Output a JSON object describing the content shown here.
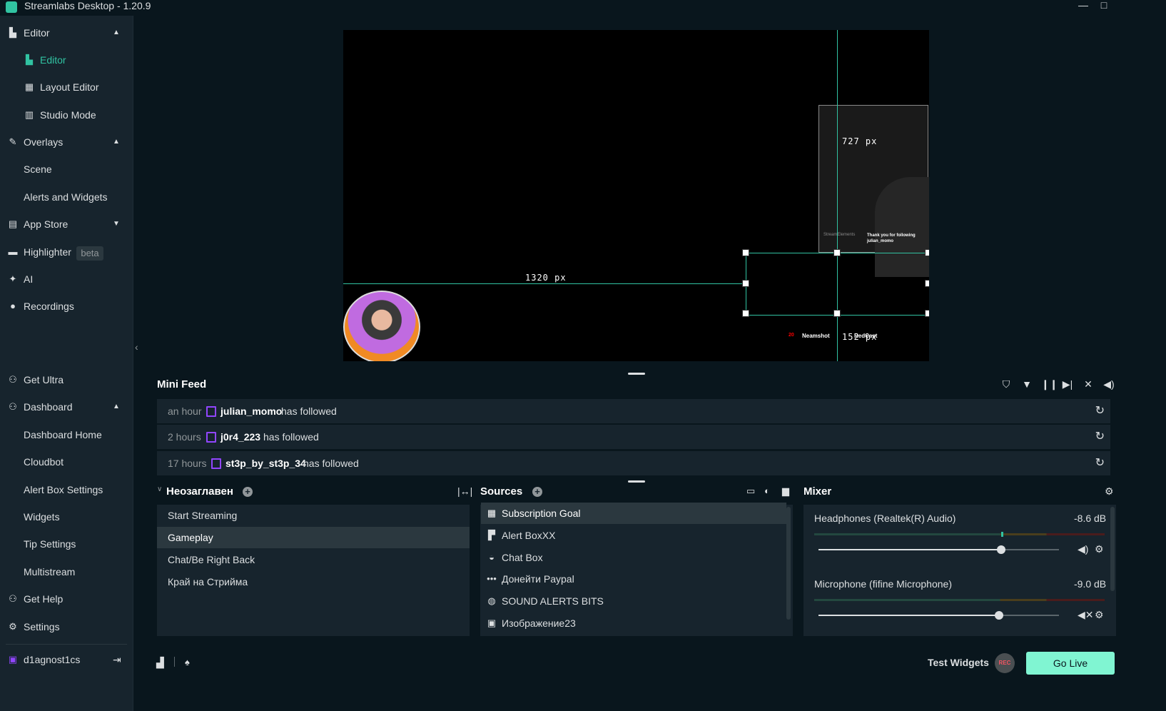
{
  "window": {
    "title": "Streamlabs Desktop - 1.20.9",
    "minimize": "—",
    "maximize": "□"
  },
  "sidebar": {
    "editor_group": "Editor",
    "editor_items": [
      "Editor",
      "Layout Editor",
      "Studio Mode"
    ],
    "overlays_group": "Overlays",
    "overlays_items": [
      "Scene",
      "Alerts and Widgets"
    ],
    "app_store": "App Store",
    "highlighter": "Highlighter",
    "highlighter_badge": "beta",
    "ai": "AI",
    "recordings": "Recordings",
    "get_ultra": "Get Ultra",
    "dashboard_group": "Dashboard",
    "dashboard_items": [
      "Dashboard Home",
      "Cloudbot",
      "Alert Box Settings",
      "Widgets",
      "Tip Settings",
      "Multistream"
    ],
    "get_help": "Get Help",
    "settings": "Settings",
    "username": "d1agnost1cs"
  },
  "canvas": {
    "label_727": "727 px",
    "label_1320": "1320 px",
    "label_152": "152 px",
    "follow_alert_brand": "StreamElements",
    "follow_alert_text": "Thank you for following",
    "follow_alert_user": "julian_momo",
    "ticker_num": "20",
    "ticker_a": "Neamshot",
    "ticker_b": "RedCast"
  },
  "minifeed": {
    "title": "Mini Feed",
    "rows": [
      {
        "time": "an hour",
        "user": "julian_momo",
        "action": "has followed"
      },
      {
        "time": "2 hours",
        "user": "j0r4_223",
        "action": "has followed"
      },
      {
        "time": "17 hours",
        "user": "st3p_by_st3p_34",
        "action": "has followed"
      }
    ]
  },
  "scenes": {
    "collection": "Неозаглавен",
    "items": [
      "Start Streaming",
      "Gameplay",
      "Chat/Be Right Back",
      "Край на Стрийма"
    ],
    "selected": "Gameplay"
  },
  "sources": {
    "title": "Sources",
    "items": [
      {
        "label": "Subscription Goal",
        "icon": "calendar-icon"
      },
      {
        "label": "Alert BoxXX",
        "icon": "alert-box-icon"
      },
      {
        "label": "Chat Box",
        "icon": "chat-icon"
      },
      {
        "label": "Донейти Paypal",
        "icon": "more-dots-icon"
      },
      {
        "label": "SOUND ALERTS BITS",
        "icon": "globe-icon"
      },
      {
        "label": "Изображение23",
        "icon": "image-icon"
      }
    ]
  },
  "mixer": {
    "title": "Mixer",
    "channels": [
      {
        "name": "Headphones (Realtek(R) Audio)",
        "db": "-8.6 dB",
        "volume": 0.76,
        "muted": false
      },
      {
        "name": "Microphone (fifine Microphone)",
        "db": "-9.0 dB",
        "volume": 0.75,
        "muted": true
      }
    ]
  },
  "footer": {
    "test_widgets": "Test Widgets",
    "rec": "REC",
    "go_live": "Go Live"
  },
  "colors": {
    "accent": "#31c3a2",
    "go_live": "#80f5d2",
    "twitch": "#9146ff",
    "panel": "#17242d",
    "bg": "#09161d"
  }
}
